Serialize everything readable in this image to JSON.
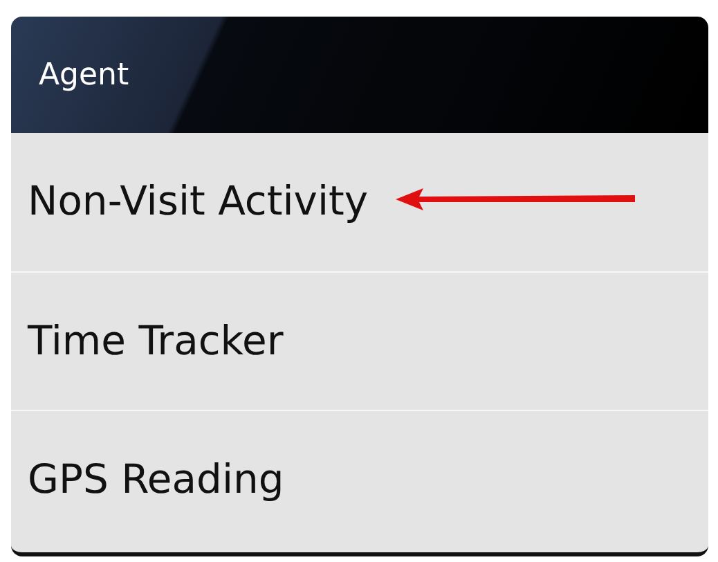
{
  "menu": {
    "title": "Agent",
    "items": [
      {
        "label": "Non-Visit Activity",
        "highlighted": true
      },
      {
        "label": "Time Tracker",
        "highlighted": false
      },
      {
        "label": "GPS Reading",
        "highlighted": false
      }
    ]
  }
}
